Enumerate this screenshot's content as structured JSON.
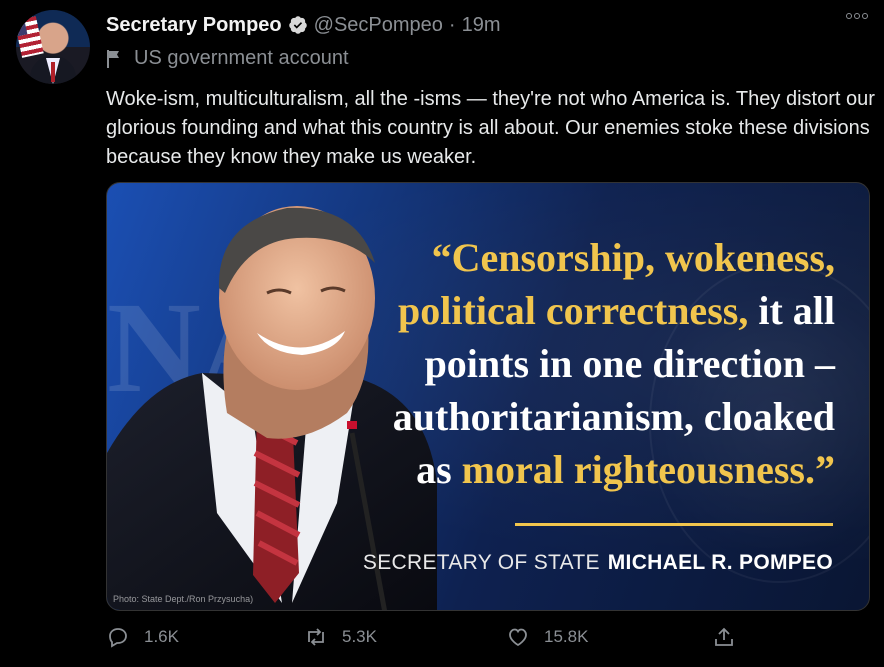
{
  "author": {
    "name": "Secretary Pompeo",
    "handle": "@SecPompeo",
    "separator": "·",
    "time": "19m",
    "label": "US government account"
  },
  "tweet": {
    "text": "Woke-ism, multiculturalism, all the -isms — they're not who America is. They distort our glorious founding and what this country is all about. Our enemies stoke these divisions because they know they make us weaker."
  },
  "media": {
    "quote_parts": [
      {
        "text": "“Censorship, wokeness,",
        "color": "#f1c54d"
      },
      {
        "text": "political correctness,",
        "color": "#f1c54d"
      },
      {
        "text": " it all",
        "color": "#ffffff"
      },
      {
        "text": "points in one direction –",
        "color": "#ffffff"
      },
      {
        "text": "authoritarianism, cloaked",
        "color": "#ffffff"
      },
      {
        "text": "as ",
        "color": "#ffffff"
      },
      {
        "text": "moral righteousness.”",
        "color": "#f1c54d"
      }
    ],
    "attribution_title": "SECRETARY OF STATE",
    "attribution_name": "MICHAEL R. POMPEO",
    "photo_credit": "Photo: State Dept./Ron Przysucha)"
  },
  "actions": {
    "reply_count": "1.6K",
    "retweet_count": "5.3K",
    "like_count": "15.8K"
  },
  "colors": {
    "background": "#000000",
    "accent_gold": "#f1c54d",
    "muted_text": "#8b8f94",
    "media_blue": "#14377e"
  },
  "icons": [
    "verified-badge-icon",
    "flag-icon",
    "more-options-icon",
    "reply-icon",
    "retweet-icon",
    "like-icon",
    "share-icon"
  ]
}
